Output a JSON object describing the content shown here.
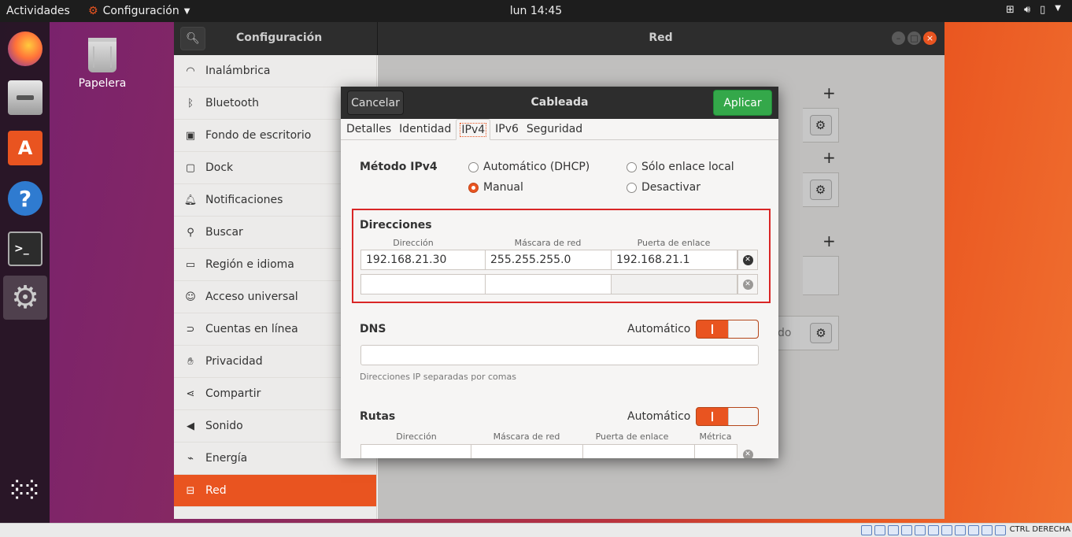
{
  "topbar": {
    "activities": "Actividades",
    "app_menu": "Configuración",
    "clock": "lun 14:45"
  },
  "desktop": {
    "trash_label": "Papelera"
  },
  "settings": {
    "search_title": "Configuración",
    "panel_title": "Red",
    "sidebar": [
      {
        "label": "Inalámbrica",
        "icon": "wifi-icon"
      },
      {
        "label": "Bluetooth",
        "icon": "bluetooth-icon"
      },
      {
        "label": "Fondo de escritorio",
        "icon": "background-icon"
      },
      {
        "label": "Dock",
        "icon": "dock-icon"
      },
      {
        "label": "Notificaciones",
        "icon": "bell-icon"
      },
      {
        "label": "Buscar",
        "icon": "search-icon"
      },
      {
        "label": "Región e idioma",
        "icon": "camera-icon"
      },
      {
        "label": "Acceso universal",
        "icon": "accessibility-icon"
      },
      {
        "label": "Cuentas en línea",
        "icon": "online-accounts-icon"
      },
      {
        "label": "Privacidad",
        "icon": "hand-icon"
      },
      {
        "label": "Compartir",
        "icon": "share-icon"
      },
      {
        "label": "Sonido",
        "icon": "speaker-icon"
      },
      {
        "label": "Energía",
        "icon": "power-icon"
      },
      {
        "label": "Red",
        "icon": "network-icon",
        "selected": true
      }
    ],
    "panel_hidden_text": "do"
  },
  "dialog": {
    "cancel": "Cancelar",
    "title": "Cableada",
    "apply": "Aplicar",
    "tabs": [
      "Detalles",
      "Identidad",
      "IPv4",
      "IPv6",
      "Seguridad"
    ],
    "active_tab": "IPv4",
    "method_label": "Método IPv4",
    "methods": [
      {
        "label": "Automático (DHCP)",
        "selected": false
      },
      {
        "label": "Sólo enlace local",
        "selected": false
      },
      {
        "label": "Manual",
        "selected": true
      },
      {
        "label": "Desactivar",
        "selected": false
      }
    ],
    "addresses": {
      "label": "Direcciones",
      "headers": [
        "Dirección",
        "Máscara de red",
        "Puerta de enlace"
      ],
      "rows": [
        [
          "192.168.21.30",
          "255.255.255.0",
          "192.168.21.1"
        ],
        [
          "",
          "",
          ""
        ]
      ]
    },
    "dns": {
      "label": "DNS",
      "auto_label": "Automático",
      "auto_on": true,
      "value": "",
      "hint": "Direcciones IP separadas por comas"
    },
    "routes": {
      "label": "Rutas",
      "auto_label": "Automático",
      "auto_on": true,
      "headers": [
        "Dirección",
        "Máscara de red",
        "Puerta de enlace",
        "Métrica"
      ]
    }
  },
  "statusbar": {
    "host_key": "CTRL DERECHA"
  },
  "colors": {
    "accent": "#e95420",
    "apply_green": "#34a84a",
    "highlight_red": "#d92626"
  }
}
